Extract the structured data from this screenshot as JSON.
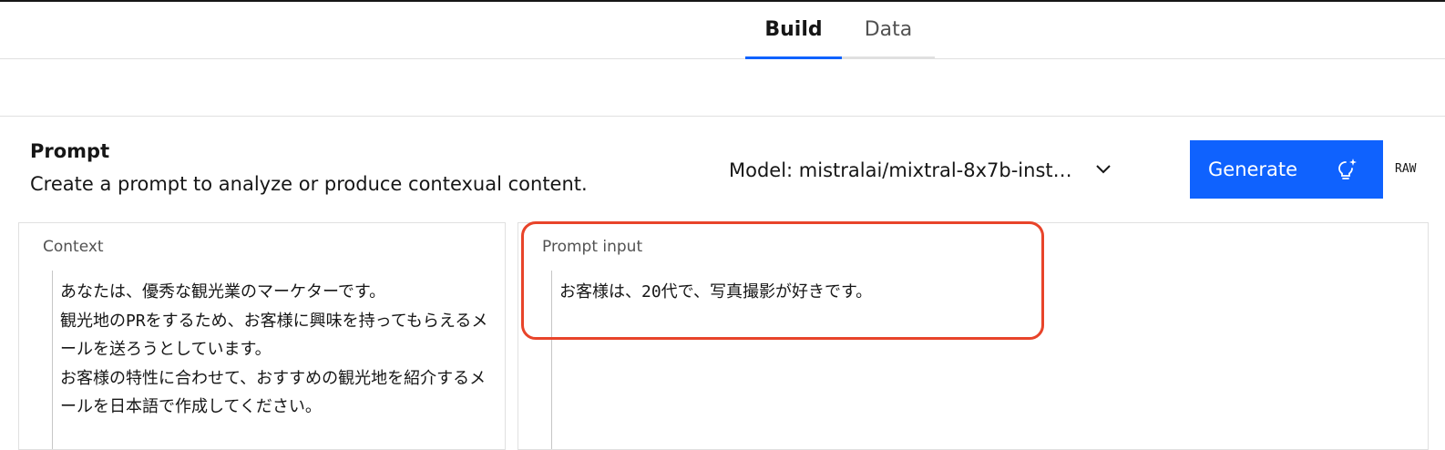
{
  "tabs": [
    {
      "label": "Build",
      "active": true
    },
    {
      "label": "Data",
      "active": false
    }
  ],
  "prompt": {
    "title": "Prompt",
    "description": "Create a prompt to analyze or produce contexual content."
  },
  "model_select": {
    "label": "Model: mistralai/mixtral-8x7b-inst…",
    "icon": "chevron-down-icon"
  },
  "generate": {
    "label": "Generate",
    "icon": "lightbulb-sparkle-icon",
    "color": "#0f62fe"
  },
  "raw_label": "RAW",
  "context": {
    "label": "Context",
    "value": "あなたは、優秀な観光業のマーケターです。\n観光地のPRをするため、お客様に興味を持ってもらえるメールを送ろうとしています。\nお客様の特性に合わせて、おすすめの観光地を紹介するメールを日本語で作成してください。"
  },
  "prompt_input": {
    "label": "Prompt input",
    "value": "お客様は、20代で、写真撮影が好きです。"
  },
  "colors": {
    "accent": "#0f62fe",
    "highlight": "#e8442a"
  }
}
